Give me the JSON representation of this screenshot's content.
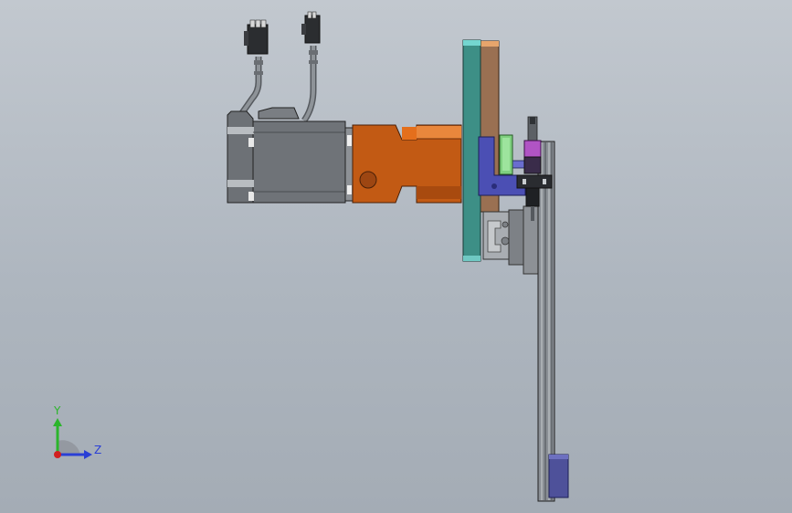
{
  "viewport": {
    "background_top": "#c2c8cf",
    "background_bottom": "#a4acb5"
  },
  "triad": {
    "y_label": "Y",
    "z_label": "Z",
    "y_color": "#2bb52b",
    "z_color": "#2a3fd6",
    "x_color": "#d21f1f"
  },
  "part_colors": {
    "motor_body": "#6f7378",
    "gearbox": "#c25a14",
    "plate_teal": "#3d8f86",
    "plate_brown": "#9a7052",
    "bracket_blue": "#4b4fb4",
    "block_green": "#7fd07f",
    "block_purple": "#b054c4",
    "rail": "#8a8f95",
    "end_block": "#4e519a"
  }
}
